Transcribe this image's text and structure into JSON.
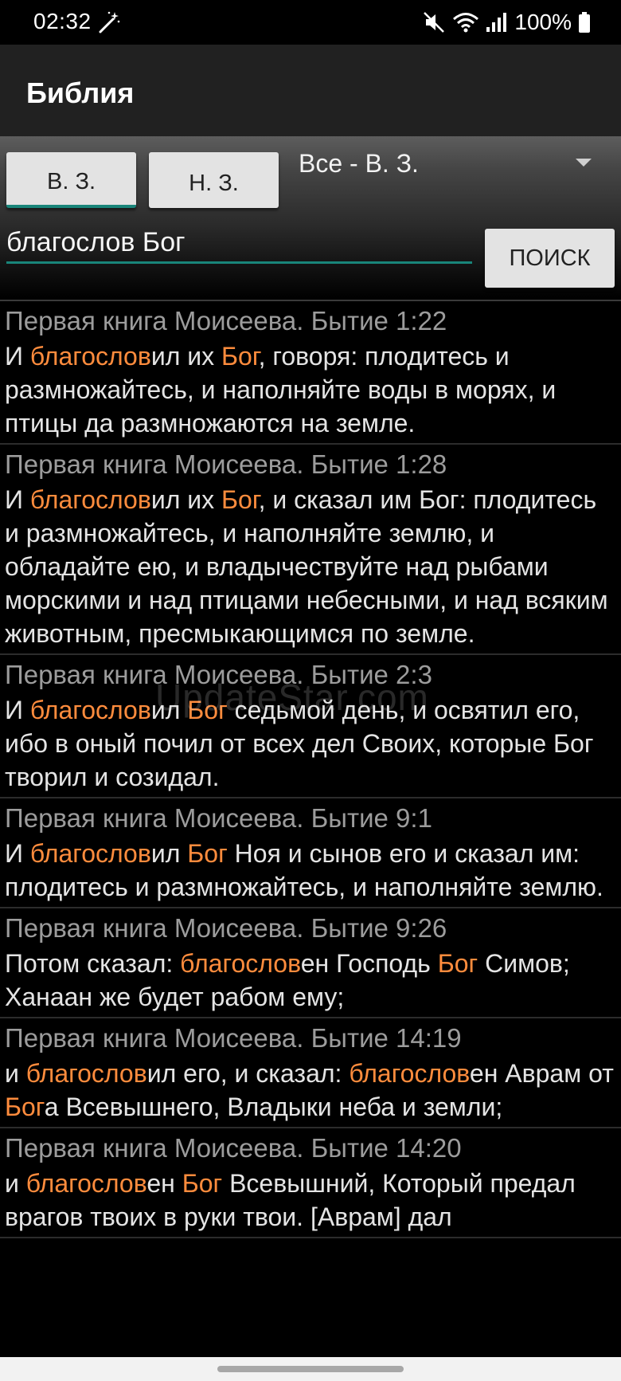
{
  "status_bar": {
    "time": "02:32",
    "battery": "100%",
    "icons": [
      "magic-wand-icon",
      "mute-icon",
      "wifi-icon",
      "signal-icon",
      "battery-icon"
    ]
  },
  "app_bar": {
    "title": "Библия"
  },
  "controls": {
    "old_testament_label": "В. З.",
    "new_testament_label": "Н. З.",
    "book_filter_value": "Все - В. З.",
    "search_value": "благослов Бог",
    "search_button_label": "ПОИСК"
  },
  "colors": {
    "accent": "#19857a",
    "highlight": "#ff8c3d",
    "reference": "#9c9c9c"
  },
  "results": [
    {
      "reference": "Первая книга Моисеева. Бытие 1:22",
      "segments": [
        {
          "t": "И ",
          "h": false
        },
        {
          "t": "благослов",
          "h": true
        },
        {
          "t": "ил их ",
          "h": false
        },
        {
          "t": "Бог",
          "h": true
        },
        {
          "t": ", говоря: плодитесь и размножайтесь, и наполняйте воды в морях, и птицы да размножаются на земле.",
          "h": false
        }
      ]
    },
    {
      "reference": "Первая книга Моисеева. Бытие 1:28",
      "segments": [
        {
          "t": "И ",
          "h": false
        },
        {
          "t": "благослов",
          "h": true
        },
        {
          "t": "ил их ",
          "h": false
        },
        {
          "t": "Бог",
          "h": true
        },
        {
          "t": ", и сказал им Бог: плодитесь и размножайтесь, и наполняйте землю, и обладайте ею, и владычествуйте над рыбами морскими и над птицами небесными, и над всяким животным, пресмыкающимся по земле.",
          "h": false
        }
      ]
    },
    {
      "reference": "Первая книга Моисеева. Бытие 2:3",
      "segments": [
        {
          "t": "И ",
          "h": false
        },
        {
          "t": "благослов",
          "h": true
        },
        {
          "t": "ил ",
          "h": false
        },
        {
          "t": "Бог",
          "h": true
        },
        {
          "t": " седьмой день, и освятил его, ибо в оный почил от всех дел Своих, которые Бог творил и созидал.",
          "h": false
        }
      ]
    },
    {
      "reference": "Первая книга Моисеева. Бытие 9:1",
      "segments": [
        {
          "t": "И ",
          "h": false
        },
        {
          "t": "благослов",
          "h": true
        },
        {
          "t": "ил ",
          "h": false
        },
        {
          "t": "Бог",
          "h": true
        },
        {
          "t": " Ноя и сынов его и сказал им: плодитесь и размножайтесь, и наполняйте землю.",
          "h": false
        }
      ]
    },
    {
      "reference": "Первая книга Моисеева. Бытие 9:26",
      "segments": [
        {
          "t": "Потом сказал: ",
          "h": false
        },
        {
          "t": "благослов",
          "h": true
        },
        {
          "t": "ен Господь ",
          "h": false
        },
        {
          "t": "Бог",
          "h": true
        },
        {
          "t": " Симов; Ханаан же будет рабом ему;",
          "h": false
        }
      ]
    },
    {
      "reference": "Первая книга Моисеева. Бытие 14:19",
      "segments": [
        {
          "t": "и ",
          "h": false
        },
        {
          "t": "благослов",
          "h": true
        },
        {
          "t": "ил его, и сказал: ",
          "h": false
        },
        {
          "t": "благослов",
          "h": true
        },
        {
          "t": "ен Аврам от ",
          "h": false
        },
        {
          "t": "Бог",
          "h": true
        },
        {
          "t": "а Всевышнего, Владыки неба и земли;",
          "h": false
        }
      ]
    },
    {
      "reference": "Первая книга Моисеева. Бытие 14:20",
      "segments": [
        {
          "t": "и ",
          "h": false
        },
        {
          "t": "благослов",
          "h": true
        },
        {
          "t": "ен ",
          "h": false
        },
        {
          "t": "Бог",
          "h": true
        },
        {
          "t": " Всевышний, Который предал врагов твоих в руки твои. [Аврам] дал",
          "h": false
        }
      ]
    }
  ],
  "watermark": "UpdateStar.com"
}
